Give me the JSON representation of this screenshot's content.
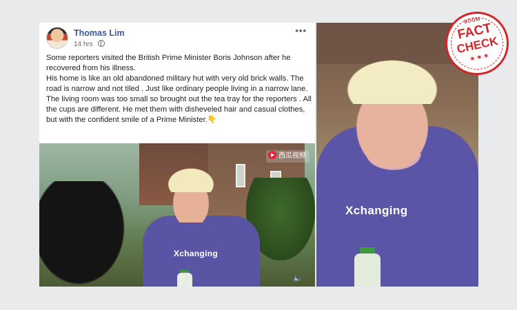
{
  "post": {
    "author": "Thomas Lim",
    "timestamp": "14 hrs",
    "visibility_icon": "globe-icon",
    "more_icon": "more-icon",
    "text": [
      "Some reporters visited the British Prime Minister Boris Johnson after he recovered from his illness.",
      "His home is like an old abandoned military hut with very old brick walls. The road is narrow and not tiled . Just like ordinary people living in a narrow lane.",
      "The living room was too small so brought out the tea tray for the reporters . All the cups are different. He met them with disheveled hair and casual clothes, but with the confident smile of a Prime Minister.👇"
    ],
    "video": {
      "badge": "西瓜视频",
      "shirt_text": "Xchanging",
      "volume_icon": "volume-icon"
    }
  },
  "photo": {
    "shirt_text": "Xchanging"
  },
  "stamp": {
    "brand": "BOOM",
    "line1": "FACT",
    "line2": "CHECK",
    "stars": "★★★"
  },
  "colors": {
    "link_blue": "#385898",
    "stamp_red": "#d1262a",
    "shirt_purple": "#5b55a8"
  }
}
